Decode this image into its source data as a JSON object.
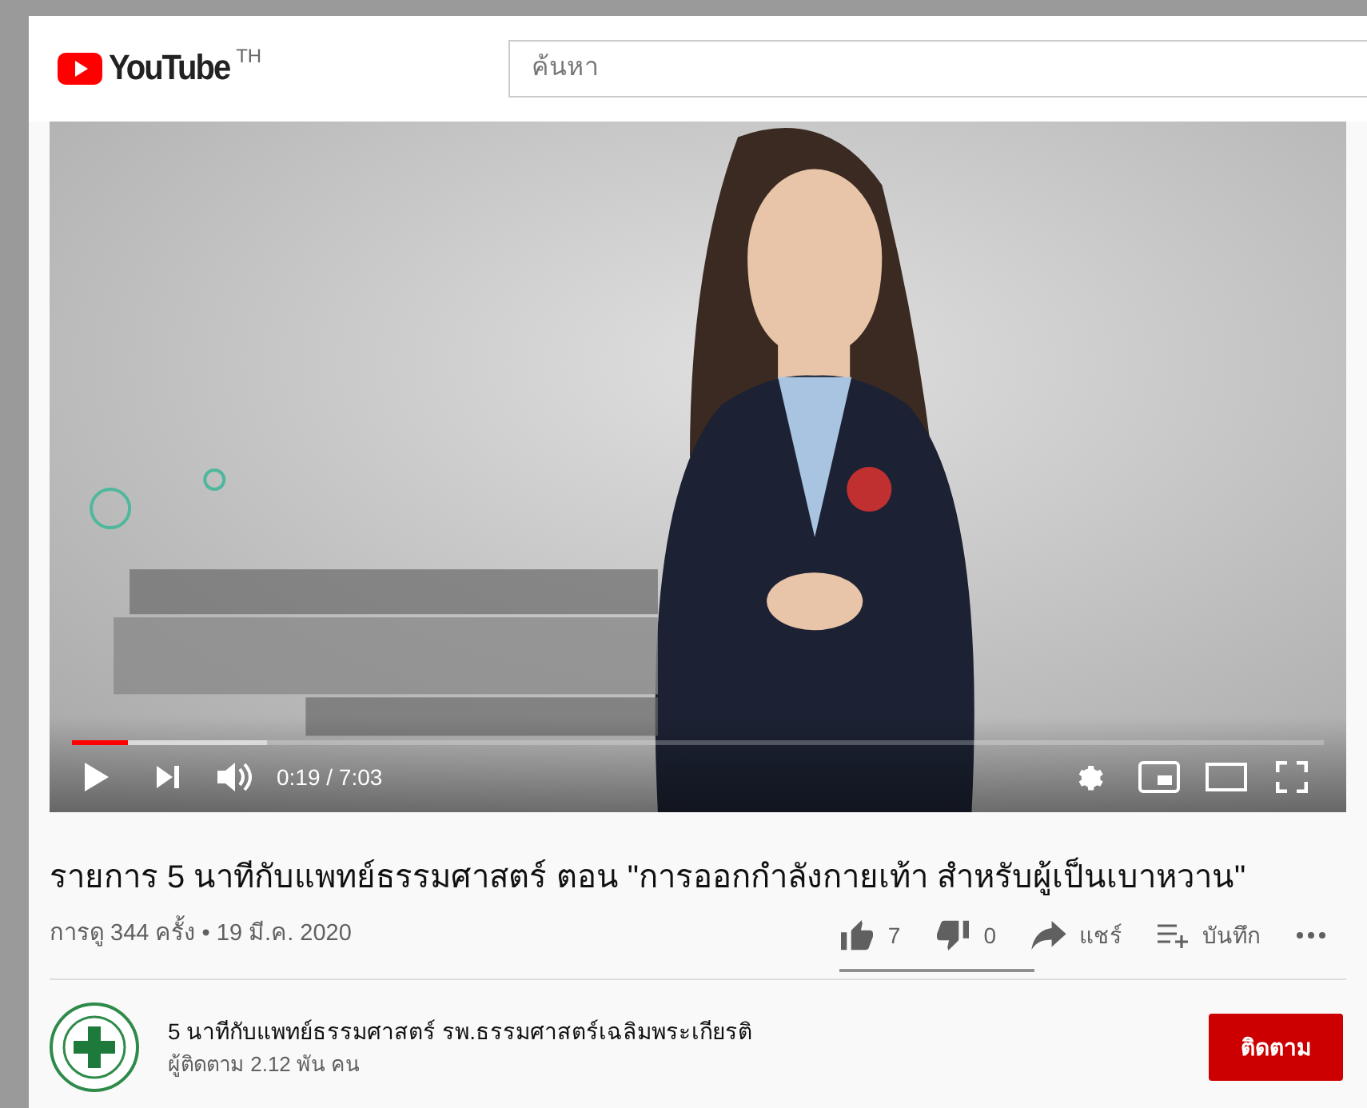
{
  "header": {
    "logo_text": "YouTube",
    "region": "TH",
    "search": {
      "placeholder": "ค้นหา"
    }
  },
  "player": {
    "progress": {
      "level": 0.045
    },
    "buffer": {
      "level": 0.156
    },
    "time": "0:19 / 7:03"
  },
  "video": {
    "title": "รายการ 5 นาทีกับแพทย์ธรรมศาสตร์ ตอน \"การออกกำลังกายเท้า สำหรับผู้เป็นเบาหวาน\"",
    "meta": "การดู 344 ครั้ง • 19 มี.ค. 2020"
  },
  "actions": [
    {
      "kind": "like",
      "label": "7"
    },
    {
      "kind": "dislike",
      "label": "0"
    },
    {
      "kind": "share",
      "label": "แชร์"
    },
    {
      "kind": "save",
      "label": "บันทึก"
    },
    {
      "kind": "more"
    }
  ],
  "sentiment": {
    "level": 1
  },
  "channel": {
    "name": "5 นาทีกับแพทย์ธรรมศาสตร์ รพ.ธรรมศาสตร์เฉลิมพระเกียรติ",
    "subscribers": "ผู้ติดตาม 2.12 พัน คน",
    "subscribe_label": "ติดตาม"
  }
}
